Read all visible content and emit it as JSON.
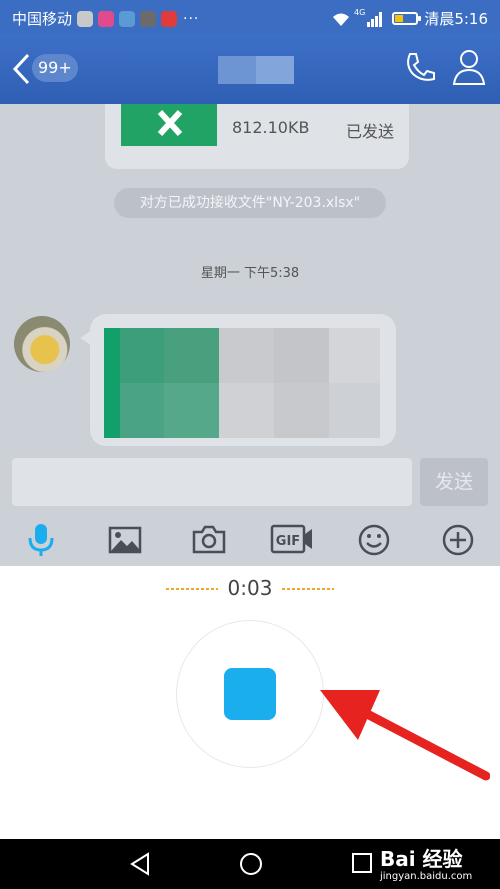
{
  "status_bar": {
    "carrier": "中国移动",
    "overflow": "···",
    "network": "4G",
    "time": "清晨5:16",
    "app_colors": [
      "#c9c9c9",
      "#e24a8d",
      "#5b9bd5",
      "#6b6b6b",
      "#e23b3b"
    ]
  },
  "header": {
    "unread_badge": "99+"
  },
  "chat": {
    "file_message": {
      "size": "812.10KB",
      "status": "已发送"
    },
    "system_notice": "对方已成功接收文件\"NY-203.xlsx\"",
    "timestamp": "星期一 下午5:38"
  },
  "composer": {
    "input_value": "",
    "send_label": "发送"
  },
  "toolbar": {
    "items": [
      "mic-icon",
      "image-icon",
      "camera-icon",
      "gif-icon",
      "emoji-icon",
      "plus-icon"
    ],
    "active_color": "#1aaeef"
  },
  "recorder": {
    "elapsed": "0:03",
    "dot_color": "#f5a623",
    "stop_color": "#1aaeef"
  },
  "annotation": {
    "arrow_color": "#e6231f"
  },
  "watermark": {
    "brand": "Bai 经验",
    "url": "jingyan.baidu.com"
  }
}
